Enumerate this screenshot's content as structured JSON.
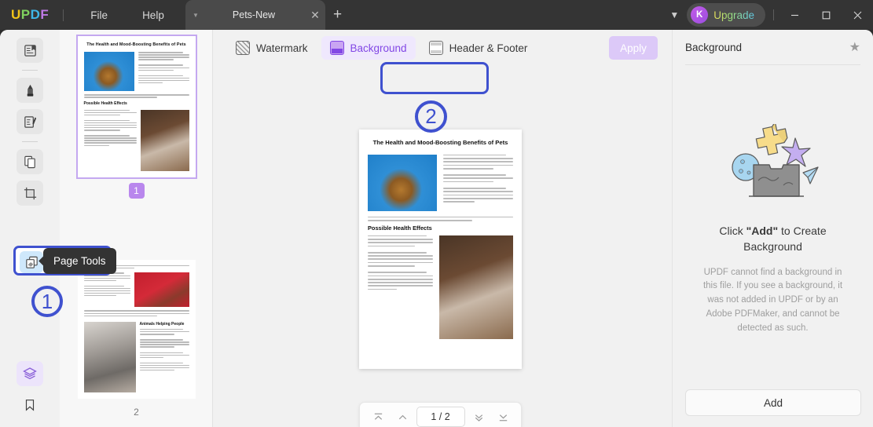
{
  "titlebar": {
    "logo": [
      "U",
      "P",
      "D",
      "F"
    ],
    "menus": [
      {
        "label": "File",
        "name": "menu-file"
      },
      {
        "label": "Help",
        "name": "menu-help"
      }
    ],
    "tab": {
      "title": "Pets-New",
      "caret_icon": "chevron-down-icon",
      "close_icon": "close-icon"
    },
    "new_tab_icon": "plus-icon",
    "chevron_icon": "chevron-down-icon",
    "upgrade": {
      "label": "Upgrade",
      "avatar_initial": "K"
    },
    "window": {
      "minimize": "—",
      "maximize": "☐",
      "close": "✕"
    }
  },
  "rail": {
    "items": [
      {
        "label": "Reader",
        "icon": "book-reader-icon"
      },
      {
        "label": "Annotate",
        "icon": "highlighter-pen-icon"
      },
      {
        "label": "Edit PDF",
        "icon": "edit-document-icon"
      },
      {
        "label": "Organize Pages",
        "icon": "pages-copy-icon"
      },
      {
        "label": "Crop",
        "icon": "crop-icon"
      },
      {
        "label": "Page Tools",
        "icon": "page-tools-icon"
      }
    ],
    "bottom": [
      {
        "label": "Layers",
        "icon": "layers-stack-icon"
      },
      {
        "label": "Bookmark",
        "icon": "bookmark-icon"
      }
    ],
    "tooltip": "Page Tools"
  },
  "callouts": [
    {
      "id": "callout-1",
      "label": "①",
      "number": "1"
    },
    {
      "id": "callout-2",
      "label": "②",
      "number": "2"
    }
  ],
  "thumbnails": {
    "pages": [
      {
        "number": "1",
        "selected": true
      },
      {
        "number": "2",
        "selected": false
      }
    ]
  },
  "toolbar": {
    "tabs": [
      {
        "label": "Watermark",
        "icon": "watermark-icon",
        "active": false
      },
      {
        "label": "Background",
        "icon": "background-icon",
        "active": true
      },
      {
        "label": "Header & Footer",
        "icon": "header-footer-icon",
        "active": false
      }
    ],
    "apply_label": "Apply"
  },
  "document": {
    "title": "The Health and Mood-Boosting Benefits of Pets",
    "heading_1": "Possible Health Effects",
    "heading_2": "Animals Helping People"
  },
  "pagenav": {
    "first_icon": "first-page-icon",
    "prev_icon": "previous-page-icon",
    "value": "1 / 2",
    "next_icon": "next-page-icon",
    "last_icon": "last-page-icon"
  },
  "right_panel": {
    "title": "Background",
    "favorite_icon": "star-icon",
    "empty_heading_pre": "Click ",
    "empty_heading_bold": "\"Add\"",
    "empty_heading_post": " to Create Background",
    "empty_body": "UPDF cannot find a background in this file. If you see a background, it was not added in UPDF or by an Adobe PDFMaker, and cannot be detected as such.",
    "add_label": "Add",
    "illustration": "empty-box-illustration"
  },
  "colors": {
    "accent_purple": "#8247e5",
    "highlight_blue": "#3f51cf",
    "panel_bg": "#f1f1f1",
    "titlebar_bg": "#343434",
    "thumb_badge": "#b987ed"
  }
}
